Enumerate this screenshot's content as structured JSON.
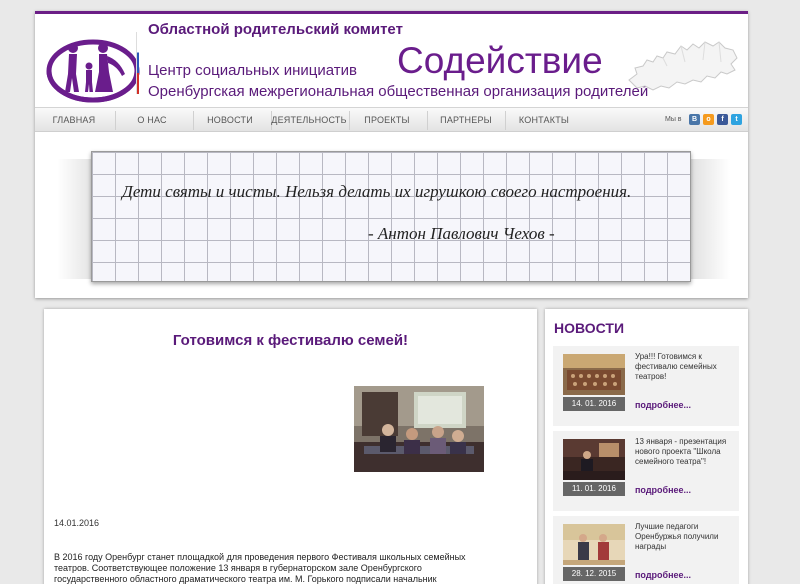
{
  "header": {
    "committee": "Областной родительский комитет",
    "center": "Центр социальных инициатив",
    "brand": "Содействие",
    "org": "Оренбургская межрегиональная  общественная организация родителей"
  },
  "nav": {
    "items": [
      "ГЛАВНАЯ",
      "О НАС",
      "НОВОСТИ",
      "ДЕЯТЕЛЬНОСТЬ",
      "ПРОЕКТЫ",
      "ПАРТНЕРЫ",
      "КОНТАКТЫ"
    ],
    "social_label": "Мы в",
    "social_icons": [
      "vk-icon",
      "odnoklassniki-icon",
      "facebook-icon",
      "twitter-icon"
    ]
  },
  "quote": {
    "text": "Дети святы и чисты. Нельзя делать их игрушкою своего настроения.",
    "author": "- Антон Павлович Чехов -"
  },
  "article": {
    "title": "Готовимся к фестивалю семей!",
    "date": "14.01.2016",
    "body_lines": [
      "В  2016 году Оренбург станет площадкой для проведения первого Фестиваля школьных семейных",
      "театров. Соответствующее положение  13 января   в губернаторском зале Оренбургского",
      "государственного областного драматического театра им. М. Горького подписали  начальник"
    ]
  },
  "news": {
    "title": "НОВОСТИ",
    "items": [
      {
        "date": "14. 01. 2016",
        "text": "Ура!!! Готовимся к фестивалю семейных театров!",
        "more": "подробнее..."
      },
      {
        "date": "11. 01. 2016",
        "text": "13 января - презентация нового проекта \"Школа семейного театра\"!",
        "more": "подробнее..."
      },
      {
        "date": "28. 12. 2015",
        "text": "Лучшие педагоги Оренбуржья получили награды",
        "more": "подробнее..."
      }
    ]
  },
  "colors": {
    "accent": "#5a1a7a",
    "header_border": "#6b1e86",
    "background": "#e9e9e9"
  }
}
